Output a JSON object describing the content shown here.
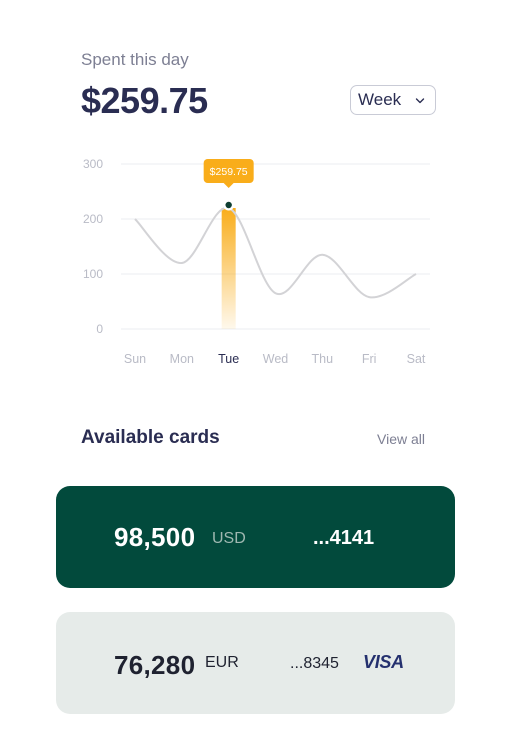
{
  "header": {
    "label": "Spent this day",
    "amount": "$259.75",
    "period": "Week"
  },
  "colors": {
    "accent": "#f9ad1a",
    "primary_text": "#2a2d52",
    "muted_text": "#7d7f93",
    "card_dark": "#024a3c",
    "card_light": "#e6ebe9"
  },
  "chart_data": {
    "type": "line",
    "categories": [
      "Sun",
      "Mon",
      "Tue",
      "Wed",
      "Thu",
      "Fri",
      "Sat"
    ],
    "values": [
      200,
      120,
      220,
      65,
      135,
      58,
      100
    ],
    "ylim": [
      0,
      300
    ],
    "yticks": [
      0,
      100,
      200,
      300
    ],
    "highlight": {
      "category": "Tue",
      "value": 220,
      "label": "$259.75"
    },
    "grid": true
  },
  "cards_section": {
    "title": "Available cards",
    "view_all": "View all"
  },
  "cards": [
    {
      "balance": "98,500",
      "currency": "USD",
      "number": "...4141",
      "brand": ""
    },
    {
      "balance": "76,280",
      "currency": "EUR",
      "number": "...8345",
      "brand": "VISA"
    }
  ]
}
